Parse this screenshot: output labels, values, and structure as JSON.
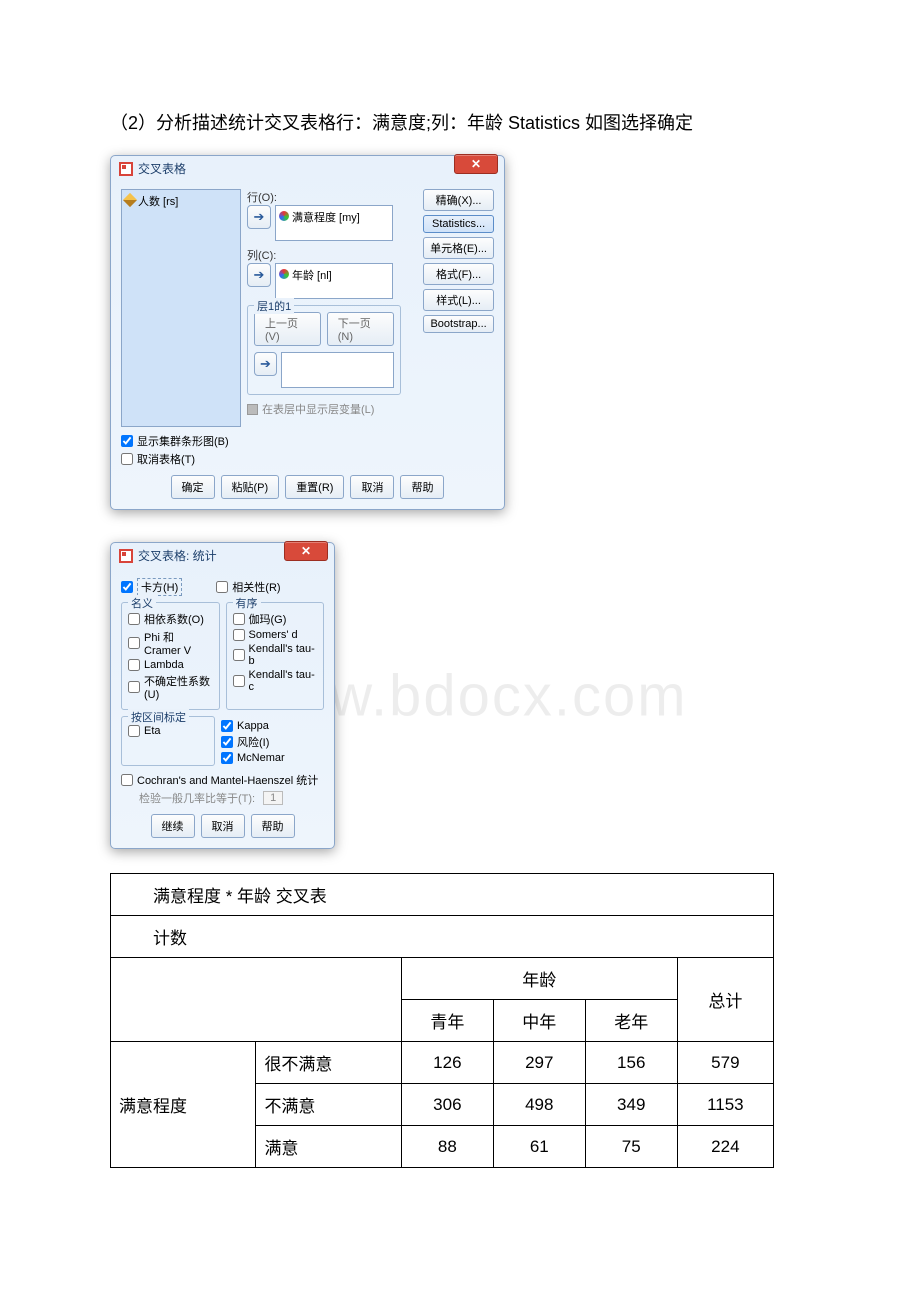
{
  "heading": "（2）分析描述统计交叉表格行：满意度;列：年龄 Statistics 如图选择确定",
  "dialog1": {
    "title": "交叉表格",
    "left_item": "人数 [rs]",
    "row_label": "行(O):",
    "row_item": "满意程度 [my]",
    "col_label": "列(C):",
    "col_item": "年龄 [nl]",
    "layer_legend": "层1的1",
    "prev": "上一页(V)",
    "next": "下一页(N)",
    "layer_var_hint": "在表层中显示层变量(L)",
    "chk_bar": "显示集群条形图(B)",
    "chk_suppress": "取消表格(T)",
    "side_buttons": [
      "精确(X)...",
      "Statistics...",
      "单元格(E)...",
      "格式(F)...",
      "样式(L)...",
      "Bootstrap..."
    ],
    "bottom_buttons": [
      "确定",
      "粘贴(P)",
      "重置(R)",
      "取消",
      "帮助"
    ]
  },
  "dialog2": {
    "title": "交叉表格: 统计",
    "chi": "卡方(H)",
    "corr": "相关性(R)",
    "nominal_legend": "名义",
    "nominal": [
      "相依系数(O)",
      "Phi 和 Cramer V",
      "Lambda",
      "不确定性系数(U)"
    ],
    "ordinal_legend": "有序",
    "ordinal": [
      "伽玛(G)",
      "Somers' d",
      "Kendall's tau-b",
      "Kendall's tau-c"
    ],
    "interval_legend": "按区间标定",
    "eta": "Eta",
    "kappa": "Kappa",
    "risk": "风险(I)",
    "mcnemar": "McNemar",
    "cmh": "Cochran's and Mantel-Haenszel 统计",
    "cmh_sub": "检验一般几率比等于(T):",
    "cmh_val": "1",
    "bottom": [
      "继续",
      "取消",
      "帮助"
    ]
  },
  "watermark": "www.bdocx.com",
  "crosstab": {
    "title": "满意程度 * 年龄 交叉表",
    "counts_label": "计数",
    "col_group": "年龄",
    "cols": [
      "青年",
      "中年",
      "老年"
    ],
    "total_label": "总计",
    "row_group": "满意程度",
    "rows": [
      {
        "label": "很不满意",
        "vals": [
          126,
          297,
          156
        ],
        "total": 579
      },
      {
        "label": "不满意",
        "vals": [
          306,
          498,
          349
        ],
        "total": 1153
      },
      {
        "label": "满意",
        "vals": [
          88,
          61,
          75
        ],
        "total": 224
      }
    ]
  }
}
